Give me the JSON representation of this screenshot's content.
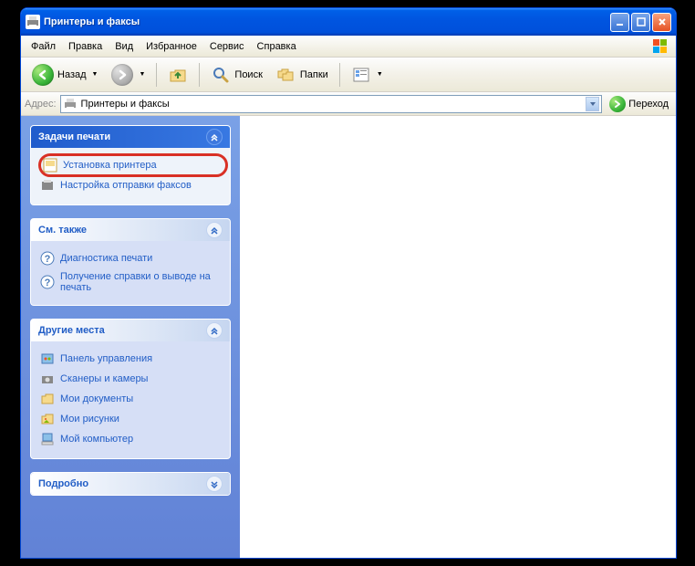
{
  "window": {
    "title": "Принтеры и факсы"
  },
  "menu": {
    "file": "Файл",
    "edit": "Правка",
    "view": "Вид",
    "favorites": "Избранное",
    "tools": "Сервис",
    "help": "Справка"
  },
  "toolbar": {
    "back": "Назад",
    "search": "Поиск",
    "folders": "Папки"
  },
  "address": {
    "label": "Адрес:",
    "value": "Принтеры и факсы",
    "go": "Переход"
  },
  "sidebar": {
    "tasks": {
      "header": "Задачи печати",
      "install_printer": "Установка принтера",
      "fax_setup": "Настройка отправки факсов"
    },
    "see_also": {
      "header": "См. также",
      "troubleshoot": "Диагностика печати",
      "help_printing": "Получение справки о выводе на печать"
    },
    "other_places": {
      "header": "Другие места",
      "control_panel": "Панель управления",
      "scanners_cameras": "Сканеры и камеры",
      "my_documents": "Мои документы",
      "my_pictures": "Мои рисунки",
      "my_computer": "Мой компьютер"
    },
    "details": {
      "header": "Подробно"
    }
  }
}
